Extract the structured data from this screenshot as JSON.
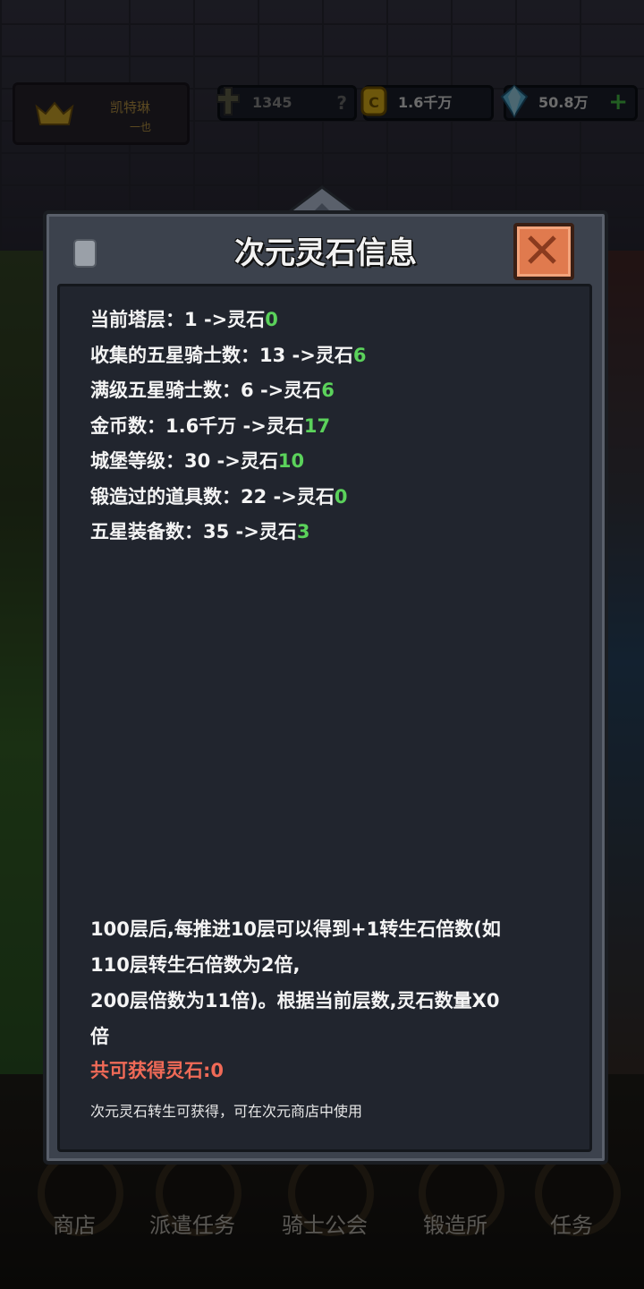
{
  "top_bar": {
    "player_name": "凯特琳",
    "player_sub": "一也",
    "power_value": "1345",
    "power_help": "?",
    "gold_value": "1.6千万",
    "gem_value": "50.8万",
    "gem_add": "+"
  },
  "modal": {
    "title": "次元灵石信息",
    "stats": [
      {
        "label": "当前塔层：",
        "value": "1",
        "arrow": "->灵石",
        "reward": "0"
      },
      {
        "label": "收集的五星骑士数：",
        "value": "13",
        "arrow": "->灵石",
        "reward": "6"
      },
      {
        "label": "满级五星骑士数：",
        "value": "6",
        "arrow": "->灵石",
        "reward": "6"
      },
      {
        "label": "金币数：",
        "value": "1.6千万",
        "arrow": "->灵石",
        "reward": "17"
      },
      {
        "label": "城堡等级：",
        "value": "30",
        "arrow": "->灵石",
        "reward": "10"
      },
      {
        "label": "锻造过的道具数：",
        "value": "22",
        "arrow": "->灵石",
        "reward": "0"
      },
      {
        "label": "五星装备数：",
        "value": "35",
        "arrow": "->灵石",
        "reward": "3"
      }
    ],
    "info_lines": [
      "100层后,每推进10层可以得到+1转生石倍数(如",
      "110层转生石倍数为2倍,",
      "200层倍数为11倍)。根据当前层数,灵石数量X0",
      "倍"
    ],
    "total": "共可获得灵石:0",
    "footnote": "次元灵石转生可获得，可在次元商店中使用"
  },
  "nav": {
    "items": [
      {
        "label": "商店"
      },
      {
        "label": "派遣任务"
      },
      {
        "label": "骑士公会"
      },
      {
        "label": "锻造所"
      },
      {
        "label": "任务"
      }
    ]
  },
  "colors": {
    "accent_green": "#5bd25b",
    "total_red": "#f06a57",
    "close_orange": "#e07a4e"
  }
}
